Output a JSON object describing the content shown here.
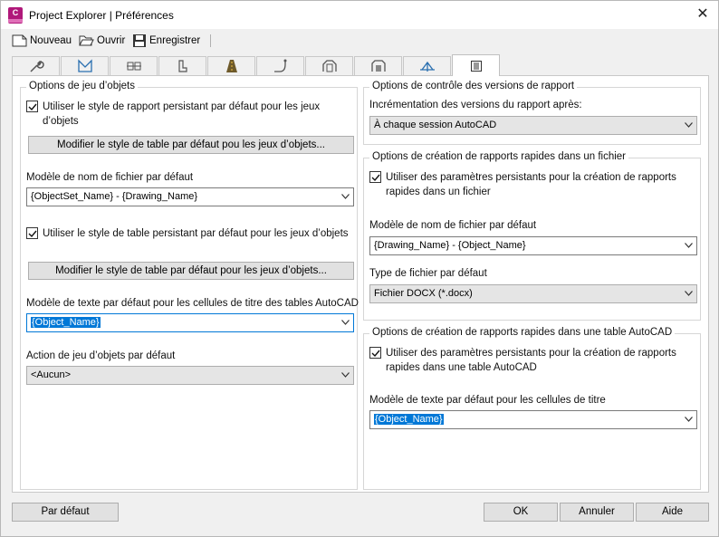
{
  "window": {
    "title": "Project Explorer | Préférences",
    "close_glyph": "✕"
  },
  "toolbar": {
    "new_label": "Nouveau",
    "open_label": "Ouvrir",
    "save_label": "Enregistrer"
  },
  "tabs": [
    {
      "icon": "wrench-icon"
    },
    {
      "icon": "surface-icon"
    },
    {
      "icon": "pipe-network-icon"
    },
    {
      "icon": "structure-icon"
    },
    {
      "icon": "corridor-icon"
    },
    {
      "icon": "alignment-icon"
    },
    {
      "icon": "assembly-icon"
    },
    {
      "icon": "subassembly-icon"
    },
    {
      "icon": "profile-icon"
    },
    {
      "icon": "report-icon"
    }
  ],
  "left": {
    "group_title": "Options de jeu d’objets",
    "persistent_report_style": {
      "checked": true,
      "label": "Utiliser le style de rapport persistant par défaut pour les jeux d’objets"
    },
    "modify_button_1": "Modifier le style de table par défaut pou les jeux d’objets...",
    "filename_label": "Modèle de nom de fichier par défaut",
    "filename_value": "{ObjectSet_Name} - {Drawing_Name}",
    "persistent_table_style": {
      "checked": true,
      "label": "Utiliser le style de table persistant par défaut pour les jeux d’objets"
    },
    "modify_button_2": "Modifier le style de table par défaut pour les jeux d’objets...",
    "title_text_label": "Modèle de texte par défaut pour les cellules de titre des tables AutoCAD",
    "title_text_value": "{Object_Name}",
    "action_label": "Action de jeu d’objets par défaut",
    "action_value": "<Aucun>"
  },
  "right": {
    "version_group": {
      "title": "Options de contrôle des versions de rapport",
      "increment_label": "Incrémentation des versions du rapport après:",
      "increment_value": "À chaque session AutoCAD"
    },
    "file_group": {
      "title": "Options de création de rapports rapides dans un fichier",
      "persistent": {
        "checked": true,
        "label": "Utiliser des paramètres persistants pour la création de rapports rapides dans un fichier"
      },
      "filename_label": "Modèle de nom de fichier par défaut",
      "filename_value": "{Drawing_Name} - {Object_Name}",
      "filetype_label": "Type de fichier par défaut",
      "filetype_value": "Fichier DOCX (*.docx)"
    },
    "table_group": {
      "title": "Options de création de rapports rapides dans une table AutoCAD",
      "persistent": {
        "checked": true,
        "label": "Utiliser des paramètres persistants pour la création de rapports rapides dans une table AutoCAD"
      },
      "title_text_label": "Modèle de texte par défaut pour les cellules de titre",
      "title_text_value": "{Object_Name}"
    }
  },
  "footer": {
    "default_button": "Par défaut",
    "ok_button": "OK",
    "cancel_button": "Annuler",
    "help_button": "Aide"
  }
}
